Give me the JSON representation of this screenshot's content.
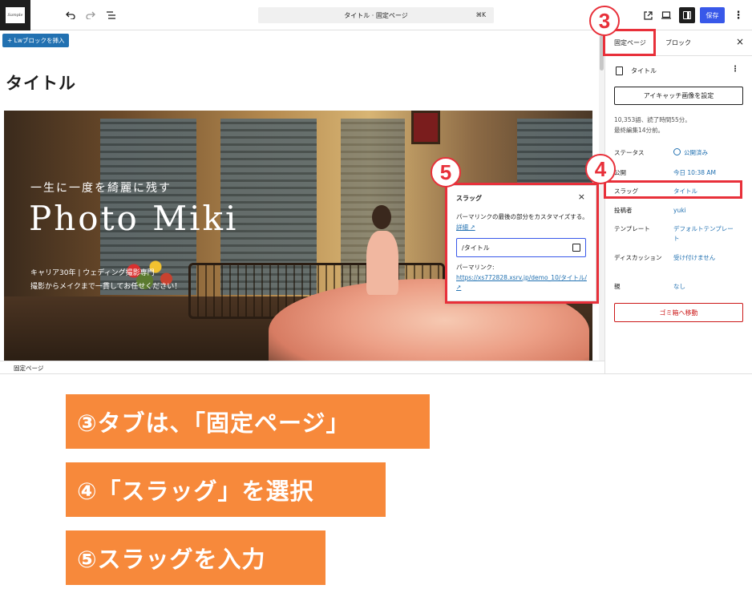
{
  "topbar": {
    "logo_text": "Sample",
    "add_label": "+",
    "undo_icon": "undo-icon",
    "redo_icon": "redo-icon",
    "list_view_icon": "list-view-icon",
    "command_title": "タイトル · 固定ページ",
    "command_shortcut": "⌘K",
    "view_icon": "external-link-icon",
    "preview_icon": "desktop-icon",
    "save_label": "保存",
    "more_label": "⋮"
  },
  "editor": {
    "insert_button": "+ Lwブロックを挿入",
    "page_title": "タイトル",
    "hero": {
      "subtitle": "一生に一度を綺麗に残す",
      "title": "Photo Miki",
      "line1": "キャリア30年 | ウェディング撮影専門",
      "line2": "撮影からメイクまで一貫してお任せください！"
    },
    "footer_breadcrumb": "固定ページ"
  },
  "slug_popover": {
    "title": "スラッグ",
    "close": "×",
    "description": "パーマリンクの最後の部分をカスタマイズする。",
    "details_link": "詳細 ↗",
    "slug_value": "/タイトル",
    "permalink_label": "パーマリンク:",
    "permalink_url": "https://xs772828.xsrv.jp/demo_10/タイトル/ ↗"
  },
  "sidebar": {
    "tabs": [
      "固定ページ",
      "ブロック"
    ],
    "close": "×",
    "doc_title": "タイトル",
    "more": "⋮",
    "featured_image_button": "アイキャッチ画像を設定",
    "word_count": "10,353語、読了時間55分。",
    "last_edited": "最終編集14分前。",
    "rows": [
      {
        "label": "ステータス",
        "value": "公開済み"
      },
      {
        "label": "公開",
        "value": "今日 10:38 AM"
      },
      {
        "label": "スラッグ",
        "value": "タイトル"
      },
      {
        "label": "投稿者",
        "value": "yuki"
      },
      {
        "label": "テンプレート",
        "value": "デフォルトテンプレート"
      },
      {
        "label": "ディスカッション",
        "value": "受け付けません"
      },
      {
        "label": "親",
        "value": "なし"
      }
    ],
    "trash_button": "ゴミ箱へ移動"
  },
  "annotations": {
    "num3": "3",
    "num4": "4",
    "num5": "5",
    "accent": "#e8303a",
    "caption_color": "#f7893b",
    "captions": [
      "③タブは、「固定ページ」",
      "④「スラッグ」を選択",
      "⑤スラッグを入力"
    ]
  }
}
